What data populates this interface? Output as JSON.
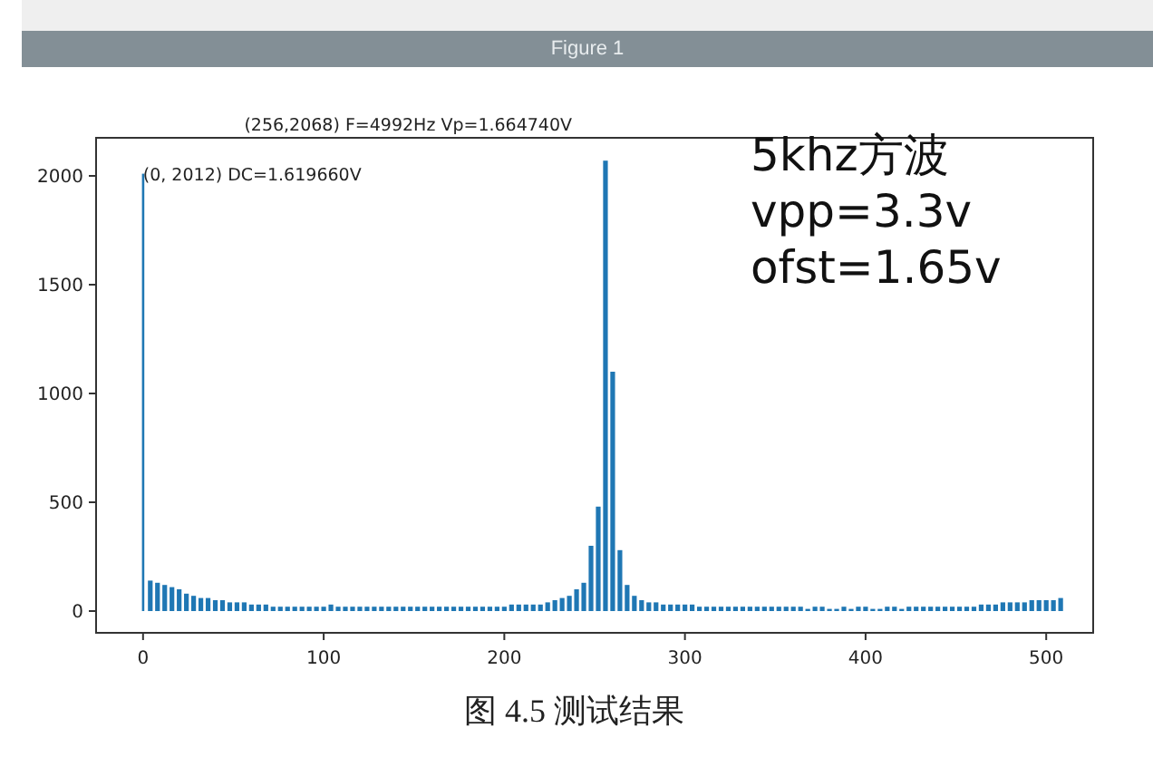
{
  "window": {
    "title": "Figure 1"
  },
  "figure": {
    "note": [
      "5khz方波",
      "vpp=3.3v",
      "ofst=1.65v"
    ],
    "chart_data": {
      "type": "bar",
      "xlim": [
        -26,
        526
      ],
      "ylim": [
        -100,
        2175
      ],
      "xticks": [
        0,
        100,
        200,
        300,
        400,
        500
      ],
      "yticks": [
        0,
        500,
        1000,
        1500,
        2000
      ],
      "x": [
        0,
        4,
        8,
        12,
        16,
        20,
        24,
        28,
        32,
        36,
        40,
        44,
        48,
        52,
        56,
        60,
        64,
        68,
        72,
        76,
        80,
        84,
        88,
        92,
        96,
        100,
        104,
        108,
        112,
        116,
        120,
        124,
        128,
        132,
        136,
        140,
        144,
        148,
        152,
        156,
        160,
        164,
        168,
        172,
        176,
        180,
        184,
        188,
        192,
        196,
        200,
        204,
        208,
        212,
        216,
        220,
        224,
        228,
        232,
        236,
        240,
        244,
        248,
        252,
        256,
        260,
        264,
        268,
        272,
        276,
        280,
        284,
        288,
        292,
        296,
        300,
        304,
        308,
        312,
        316,
        320,
        324,
        328,
        332,
        336,
        340,
        344,
        348,
        352,
        356,
        360,
        364,
        368,
        372,
        376,
        380,
        384,
        388,
        392,
        396,
        400,
        404,
        408,
        412,
        416,
        420,
        424,
        428,
        432,
        436,
        440,
        444,
        448,
        452,
        456,
        460,
        464,
        468,
        472,
        476,
        480,
        484,
        488,
        492,
        496,
        500,
        504,
        508
      ],
      "series": [
        {
          "color": "#1f77b4",
          "values": [
            2010,
            140,
            130,
            120,
            110,
            100,
            80,
            70,
            60,
            60,
            50,
            50,
            40,
            40,
            40,
            30,
            30,
            30,
            20,
            20,
            20,
            20,
            20,
            20,
            20,
            20,
            30,
            20,
            20,
            20,
            20,
            20,
            20,
            20,
            20,
            20,
            20,
            20,
            20,
            20,
            20,
            20,
            20,
            20,
            20,
            20,
            20,
            20,
            20,
            20,
            20,
            30,
            30,
            30,
            30,
            30,
            40,
            50,
            60,
            70,
            100,
            130,
            300,
            480,
            2070,
            1100,
            280,
            120,
            70,
            50,
            40,
            40,
            30,
            30,
            30,
            30,
            30,
            20,
            20,
            20,
            20,
            20,
            20,
            20,
            20,
            20,
            20,
            20,
            20,
            20,
            20,
            20,
            10,
            20,
            20,
            10,
            10,
            20,
            10,
            20,
            20,
            10,
            10,
            20,
            20,
            10,
            20,
            20,
            20,
            20,
            20,
            20,
            20,
            20,
            20,
            20,
            30,
            30,
            30,
            40,
            40,
            40,
            40,
            50,
            50,
            50,
            50,
            60
          ]
        }
      ],
      "annotations": [
        "(256,2068) F=4992Hz Vp=1.664740V",
        "(0, 2012) DC=1.619660V"
      ]
    }
  },
  "caption": "图 4.5 测试结果"
}
